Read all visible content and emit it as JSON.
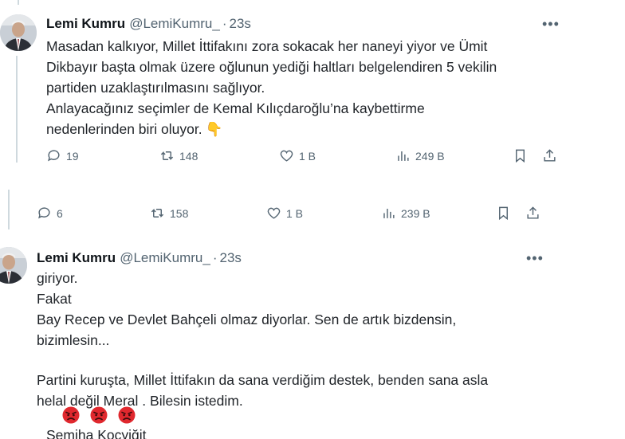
{
  "tweet_top": {
    "name": "Lemi Kumru",
    "handle": "@LemiKumru_",
    "separator": "·",
    "time": "23s",
    "more_label": "•••",
    "lines": [
      "Masadan kalkıyor, Millet İttifakını zora sokacak her naneyi yiyor ve Ümit",
      "Dikbayır başta olmak üzere oğlunun yediği haltları belgelendiren 5 vekilin",
      "partiden uzaklaştırılmasını sağlıyor.",
      "Anlayacağınız seçimler de  Kemal Kılıçdaroğlu’na kaybettirme",
      "nedenlerinden biri oluyor."
    ],
    "emoji": "👇",
    "actions": {
      "replies": "19",
      "reposts": "148",
      "likes": "1 B",
      "views": "249 B"
    }
  },
  "tweet_bottom_actions": {
    "replies": "6",
    "reposts": "158",
    "likes": "1 B",
    "views": "239 B"
  },
  "tweet_bottom": {
    "name": "Lemi Kumru",
    "handle": "@LemiKumru_",
    "separator": "·",
    "time": "23s",
    "more_label": "•••",
    "lines": [
      "giriyor.",
      "Fakat",
      "Bay Recep ve Devlet Bahçeli olmaz diyorlar. Sen de artık bizdensin,",
      "bizimlesin..."
    ],
    "lines2": [
      "Partini kuruşta, Millet İttifakın da sana  verdiğim destek, benden sana asla",
      "helal değil Meral . Bilesin istedim."
    ],
    "emojis": [
      "angry-face",
      "angry-face",
      "angry-face"
    ],
    "signature": "Semiha Koçyiğit"
  },
  "colors": {
    "text": "#0f1419",
    "secondary": "#536471",
    "thread": "#cfd9de",
    "angry": "#e0282e"
  }
}
